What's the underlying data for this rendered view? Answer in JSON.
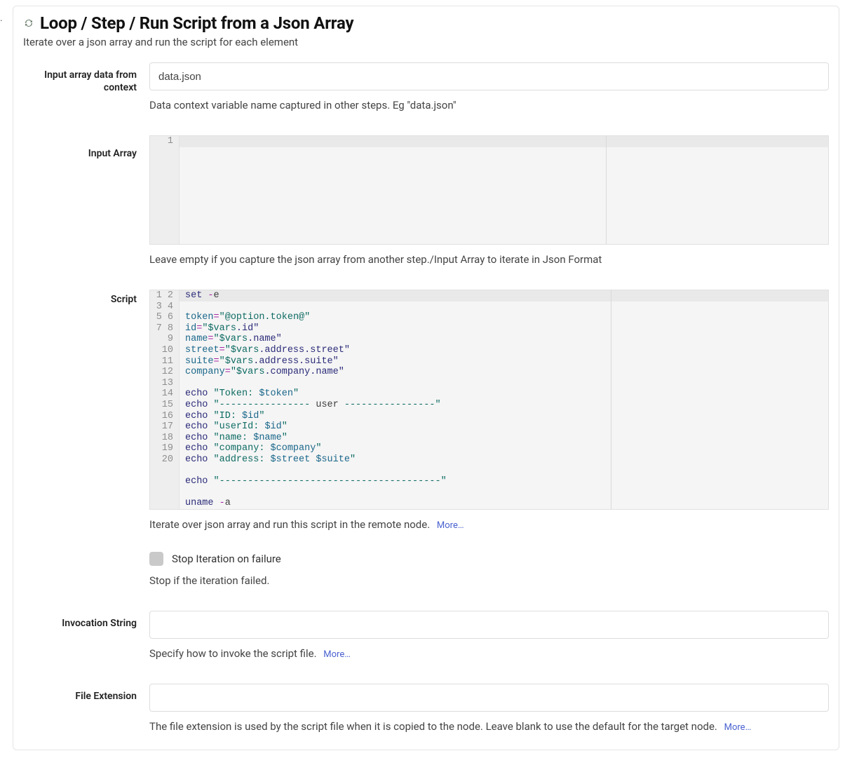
{
  "page_corner": ".",
  "header": {
    "title": "Loop / Step / Run Script from a Json Array",
    "subtitle": "Iterate over a json array and run the script for each element"
  },
  "fields": {
    "input_data": {
      "label": "Input array data from context",
      "value": "data.json",
      "help": "Data context variable name captured in other steps. Eg \"data.json\""
    },
    "input_array": {
      "label": "Input Array",
      "help": "Leave empty if you capture the json array from another step./Input Array to iterate in Json Format",
      "editor_line_count": 1,
      "content": ""
    },
    "script": {
      "label": "Script",
      "help": "Iterate over json array and run this script in the remote node.",
      "more": "More…",
      "lines": [
        {
          "n": 1,
          "tokens": [
            {
              "t": "set ",
              "c": "tok-cmd"
            },
            {
              "t": "-",
              "c": "tok-op"
            },
            {
              "t": "e",
              "c": "tok-p"
            }
          ]
        },
        {
          "n": 2,
          "tokens": []
        },
        {
          "n": 3,
          "tokens": [
            {
              "t": "token",
              "c": "tok-var"
            },
            {
              "t": "=",
              "c": "tok-op"
            },
            {
              "t": "\"@option.token@\"",
              "c": "tok-str"
            }
          ]
        },
        {
          "n": 4,
          "tokens": [
            {
              "t": "id",
              "c": "tok-var"
            },
            {
              "t": "=",
              "c": "tok-op"
            },
            {
              "t": "\"$vars",
              "c": "tok-str"
            },
            {
              "t": ".id\"",
              "c": "tok-cmd"
            }
          ]
        },
        {
          "n": 5,
          "tokens": [
            {
              "t": "name",
              "c": "tok-var"
            },
            {
              "t": "=",
              "c": "tok-op"
            },
            {
              "t": "\"$vars",
              "c": "tok-str"
            },
            {
              "t": ".name\"",
              "c": "tok-cmd"
            }
          ]
        },
        {
          "n": 6,
          "tokens": [
            {
              "t": "street",
              "c": "tok-var"
            },
            {
              "t": "=",
              "c": "tok-op"
            },
            {
              "t": "\"$vars",
              "c": "tok-str"
            },
            {
              "t": ".address.street\"",
              "c": "tok-cmd"
            }
          ]
        },
        {
          "n": 7,
          "tokens": [
            {
              "t": "suite",
              "c": "tok-var"
            },
            {
              "t": "=",
              "c": "tok-op"
            },
            {
              "t": "\"$vars",
              "c": "tok-str"
            },
            {
              "t": ".address.suite\"",
              "c": "tok-cmd"
            }
          ]
        },
        {
          "n": 8,
          "tokens": [
            {
              "t": "company",
              "c": "tok-var"
            },
            {
              "t": "=",
              "c": "tok-op"
            },
            {
              "t": "\"$vars",
              "c": "tok-str"
            },
            {
              "t": ".company.name\"",
              "c": "tok-cmd"
            }
          ]
        },
        {
          "n": 9,
          "tokens": []
        },
        {
          "n": 10,
          "tokens": [
            {
              "t": "echo ",
              "c": "tok-cmd"
            },
            {
              "t": "\"Token: ",
              "c": "tok-str"
            },
            {
              "t": "$token",
              "c": "tok-var"
            },
            {
              "t": "\"",
              "c": "tok-str"
            }
          ]
        },
        {
          "n": 11,
          "tokens": [
            {
              "t": "echo ",
              "c": "tok-cmd"
            },
            {
              "t": "\"---------------- ",
              "c": "tok-str"
            },
            {
              "t": "user ",
              "c": "tok-p"
            },
            {
              "t": "----------------\"",
              "c": "tok-str"
            }
          ]
        },
        {
          "n": 12,
          "tokens": [
            {
              "t": "echo ",
              "c": "tok-cmd"
            },
            {
              "t": "\"ID: ",
              "c": "tok-str"
            },
            {
              "t": "$id",
              "c": "tok-var"
            },
            {
              "t": "\"",
              "c": "tok-str"
            }
          ]
        },
        {
          "n": 13,
          "tokens": [
            {
              "t": "echo ",
              "c": "tok-cmd"
            },
            {
              "t": "\"userId: ",
              "c": "tok-str"
            },
            {
              "t": "$id",
              "c": "tok-var"
            },
            {
              "t": "\"",
              "c": "tok-str"
            }
          ]
        },
        {
          "n": 14,
          "tokens": [
            {
              "t": "echo ",
              "c": "tok-cmd"
            },
            {
              "t": "\"name: ",
              "c": "tok-str"
            },
            {
              "t": "$name",
              "c": "tok-var"
            },
            {
              "t": "\"",
              "c": "tok-str"
            }
          ]
        },
        {
          "n": 15,
          "tokens": [
            {
              "t": "echo ",
              "c": "tok-cmd"
            },
            {
              "t": "\"company: ",
              "c": "tok-str"
            },
            {
              "t": "$company",
              "c": "tok-var"
            },
            {
              "t": "\"",
              "c": "tok-str"
            }
          ]
        },
        {
          "n": 16,
          "tokens": [
            {
              "t": "echo ",
              "c": "tok-cmd"
            },
            {
              "t": "\"address: ",
              "c": "tok-str"
            },
            {
              "t": "$street",
              "c": "tok-var"
            },
            {
              "t": " ",
              "c": "tok-str"
            },
            {
              "t": "$suite",
              "c": "tok-var"
            },
            {
              "t": "\"",
              "c": "tok-str"
            }
          ]
        },
        {
          "n": 17,
          "tokens": []
        },
        {
          "n": 18,
          "tokens": [
            {
              "t": "echo ",
              "c": "tok-cmd"
            },
            {
              "t": "\"---------------------------------------\"",
              "c": "tok-str"
            }
          ]
        },
        {
          "n": 19,
          "tokens": []
        },
        {
          "n": 20,
          "tokens": [
            {
              "t": "uname ",
              "c": "tok-cmd"
            },
            {
              "t": "-",
              "c": "tok-op"
            },
            {
              "t": "a",
              "c": "tok-p"
            }
          ]
        }
      ]
    },
    "stop_iteration": {
      "label": "Stop Iteration on failure",
      "help": "Stop if the iteration failed.",
      "checked": false
    },
    "invocation": {
      "label": "Invocation String",
      "value": "",
      "help": "Specify how to invoke the script file.",
      "more": "More…"
    },
    "file_ext": {
      "label": "File Extension",
      "value": "",
      "help": "The file extension is used by the script file when it is copied to the node. Leave blank to use the default for the target node.",
      "more": "More…"
    }
  }
}
